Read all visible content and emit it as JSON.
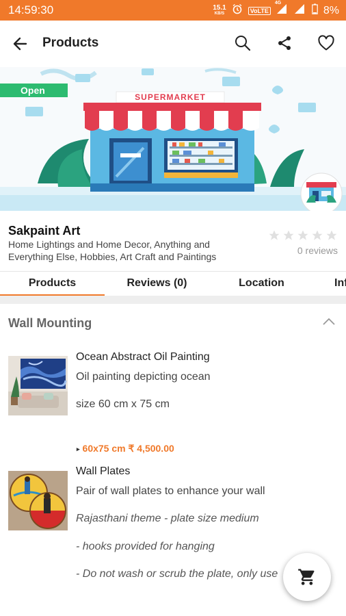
{
  "status_bar": {
    "time": "14:59:30",
    "speed": "15.1",
    "speed_unit": "KB/S",
    "volte": "VoLTE",
    "network": "4G",
    "battery": "8%"
  },
  "app_bar": {
    "title": "Products"
  },
  "store": {
    "open_label": "Open",
    "banner_sign": "SUPERMARKET",
    "name": "Sakpaint Art",
    "description": "Home Lightings and Home Decor, Anything and Everything Else, Hobbies, Art Craft and Paintings",
    "rating": 0,
    "reviews_label": "0 reviews"
  },
  "tabs": [
    {
      "label": "Products",
      "active": true
    },
    {
      "label": "Reviews (0)",
      "active": false
    },
    {
      "label": "Location",
      "active": false
    },
    {
      "label": "Info",
      "active": false
    }
  ],
  "section": {
    "title": "Wall Mounting"
  },
  "products": [
    {
      "name": "Ocean Abstract Oil Painting",
      "lines": [
        "Oil painting depicting ocean",
        "size 60 cm x 75 cm"
      ],
      "price": "60x75 cm ₹ 4,500.00"
    },
    {
      "name": "Wall Plates",
      "lines": [
        "Pair of wall plates to enhance your wall",
        "Rajasthani theme - plate size medium",
        "- hooks provided for hanging",
        "- Do not wash or scrub the plate, only use"
      ]
    }
  ],
  "colors": {
    "status_bar": "#f0792a",
    "accent": "#f0792a",
    "open_badge": "#2dbb70"
  },
  "icons": {
    "back": "arrow-left-icon",
    "search": "search-icon",
    "share": "share-icon",
    "favorite": "heart-icon",
    "cart": "cart-icon"
  }
}
